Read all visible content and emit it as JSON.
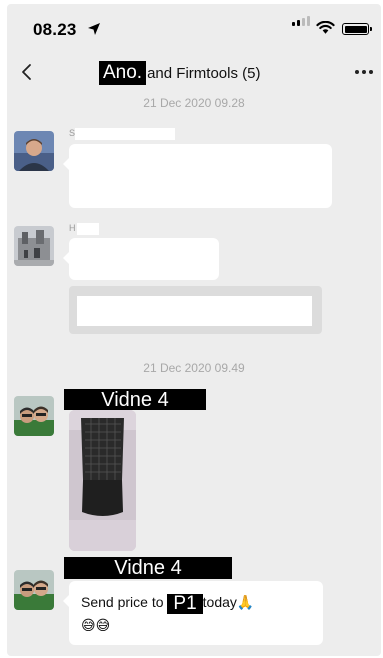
{
  "status_bar": {
    "time": "08.23",
    "icons": [
      "location-arrow-icon",
      "signal-icon",
      "wifi-icon",
      "battery-icon"
    ]
  },
  "nav": {
    "redacted_name": "Ano.",
    "title": "and Firmtools (5)",
    "back_icon": "chevron-left-icon",
    "more_icon": "ellipsis-icon"
  },
  "chat": {
    "timestamps": [
      "21 Dec 2020 09.28",
      "21 Dec 2020 09.49"
    ],
    "messages": [
      {
        "sender_initial": "S",
        "type": "text",
        "text": ""
      },
      {
        "sender_initial": "H",
        "type": "text_with_quote",
        "text": ""
      },
      {
        "sender_label": "Vidne 4",
        "type": "image"
      },
      {
        "sender_label": "Vidne 4",
        "type": "text",
        "text_before": "Send price to",
        "redacted": "P1",
        "text_after": "today",
        "emoji_inline": "🙏",
        "emoji_line": "😅😅"
      }
    ]
  }
}
